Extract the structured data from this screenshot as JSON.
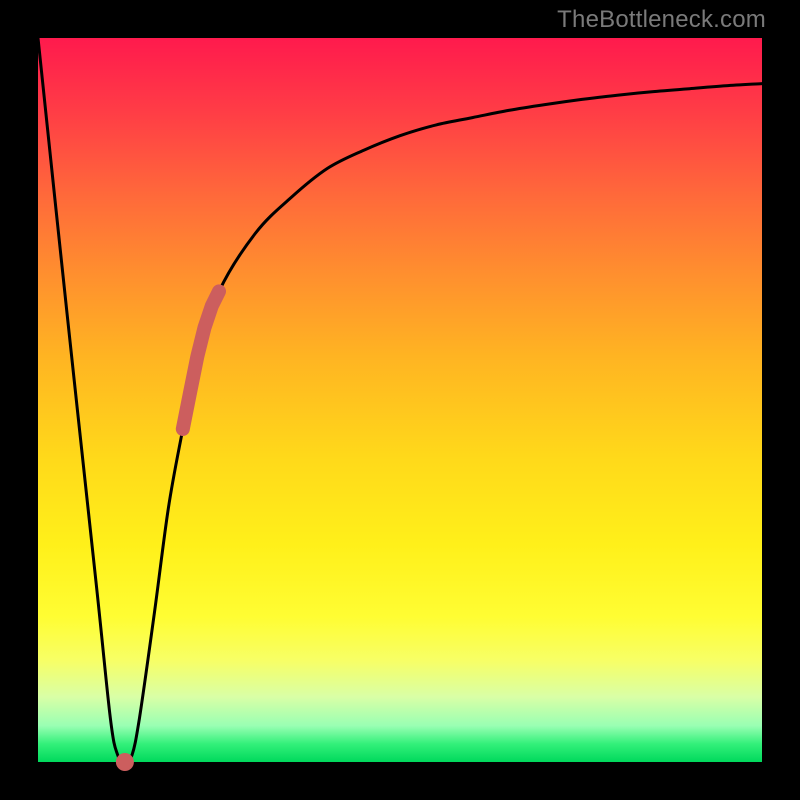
{
  "watermark": "TheBottleneck.com",
  "chart_data": {
    "type": "line",
    "title": "",
    "xlabel": "",
    "ylabel": "",
    "xlim": [
      0,
      100
    ],
    "ylim": [
      0,
      100
    ],
    "series": [
      {
        "name": "bottleneck-curve",
        "x": [
          0,
          4,
          8,
          10,
          11,
          12,
          13,
          14,
          16,
          18,
          20,
          22,
          25,
          30,
          35,
          40,
          45,
          50,
          55,
          60,
          65,
          70,
          75,
          80,
          85,
          90,
          95,
          100
        ],
        "values": [
          100,
          62,
          25,
          6,
          1,
          0,
          1,
          6,
          20,
          35,
          46,
          56,
          65,
          73,
          78,
          82,
          84.5,
          86.5,
          88,
          89,
          90,
          90.8,
          91.5,
          92.1,
          92.6,
          93,
          93.4,
          93.7
        ]
      }
    ],
    "markers": {
      "name": "highlight-segment",
      "color": "#cc5e5e",
      "x": [
        20,
        21,
        22,
        23,
        24,
        25
      ],
      "values": [
        46,
        51,
        56,
        60,
        63,
        65
      ]
    },
    "minimum_marker": {
      "name": "minimum-point",
      "color": "#cc5e5e",
      "x": 12,
      "value": 0
    }
  }
}
